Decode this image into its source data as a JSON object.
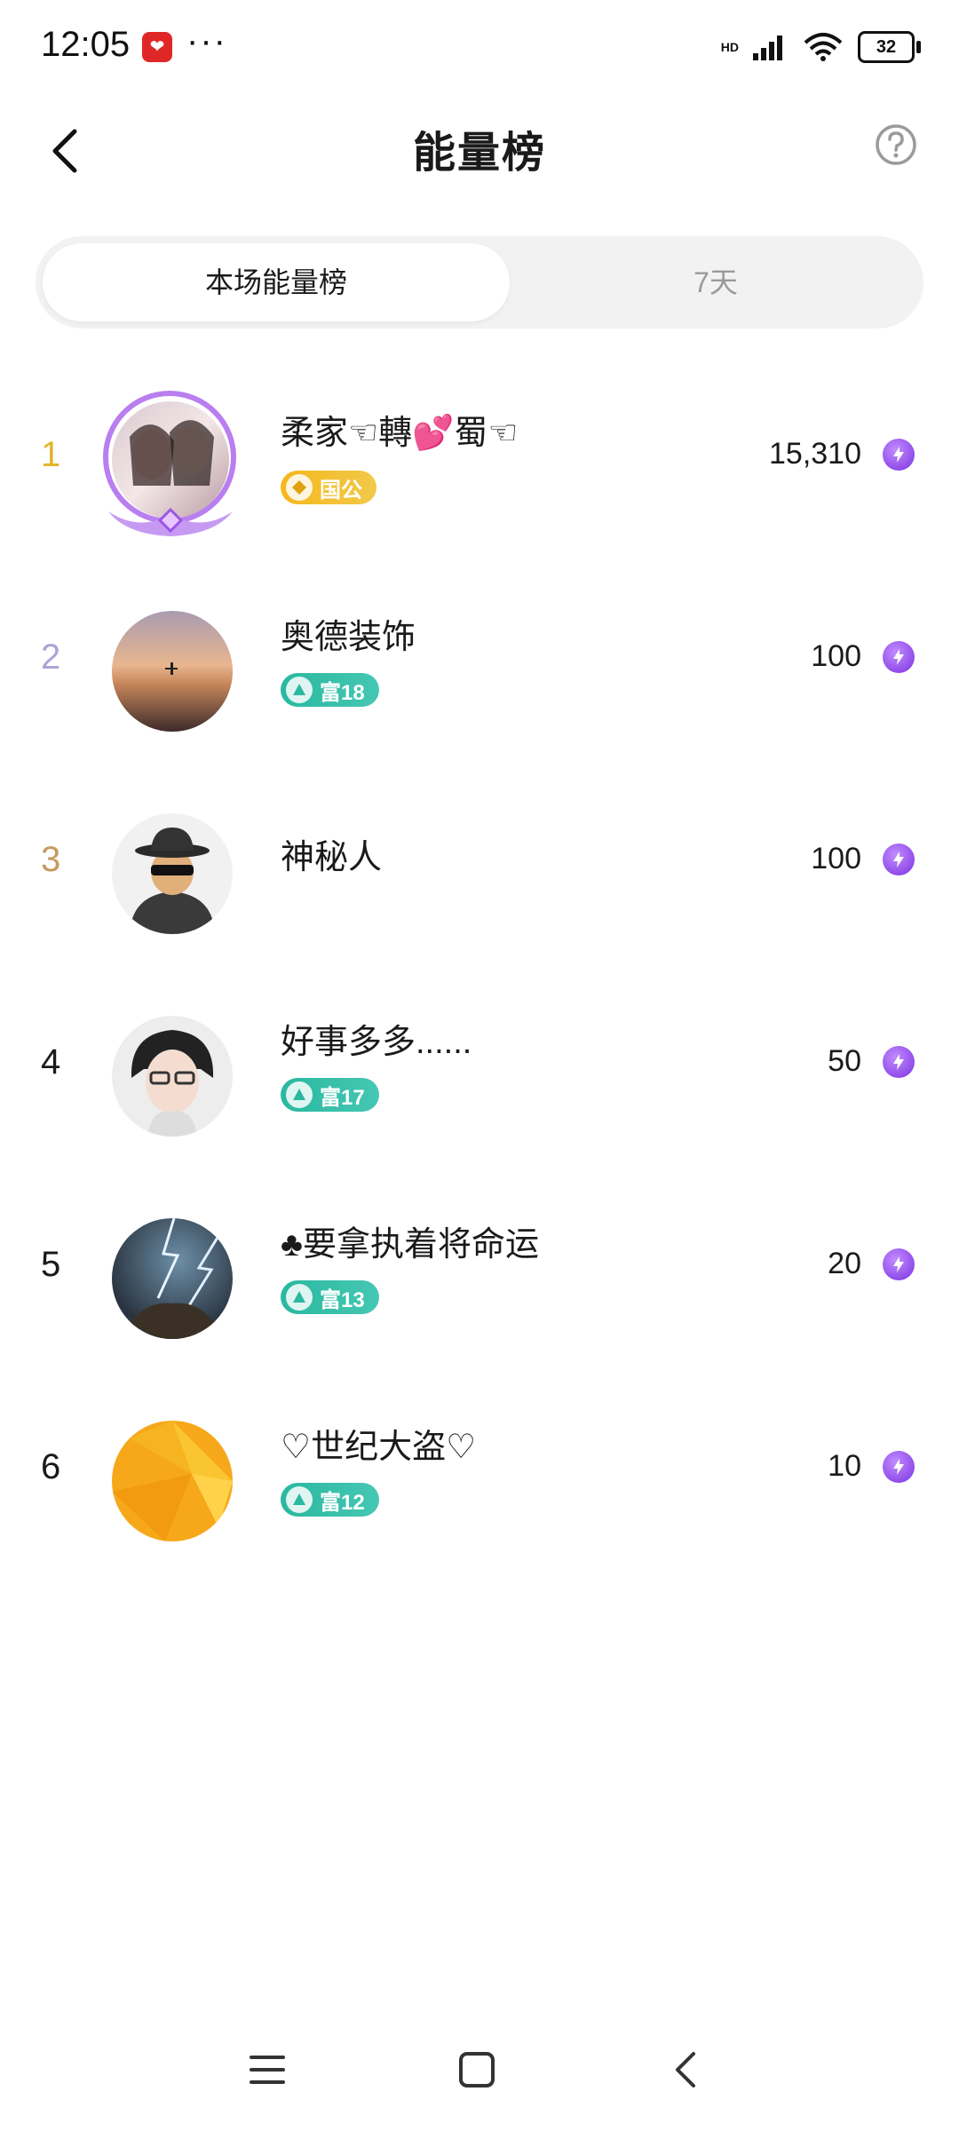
{
  "status_bar": {
    "time": "12:05",
    "app_notification": "app-icon",
    "more": "···",
    "network": "HD",
    "battery": "32"
  },
  "header": {
    "title": "能量榜",
    "back_icon": "back-icon",
    "help_icon": "question-mark-icon"
  },
  "tabs": {
    "active": "本场能量榜",
    "inactive": "7天"
  },
  "ranking": [
    {
      "rank": "1",
      "name": "柔家☜轉💕蜀☜",
      "badge": "国公",
      "badge_type": "gold",
      "score": "15,310"
    },
    {
      "rank": "2",
      "name": "奥德装饰",
      "badge": "富18",
      "badge_type": "green",
      "score": "100"
    },
    {
      "rank": "3",
      "name": "神秘人",
      "badge": "",
      "badge_type": "none",
      "score": "100"
    },
    {
      "rank": "4",
      "name": "好事多多......",
      "badge": "富17",
      "badge_type": "green",
      "score": "50"
    },
    {
      "rank": "5",
      "name": "♣要拿执着将命运",
      "badge": "富13",
      "badge_type": "green",
      "score": "20"
    },
    {
      "rank": "6",
      "name": "♡世纪大盗♡",
      "badge": "富12",
      "badge_type": "green",
      "score": "10"
    }
  ],
  "colors": {
    "rank_1": "#e4b42a",
    "rank_2": "#a9a5d8",
    "rank_3": "#c59a5c",
    "rank_other": "#1a1a1a",
    "energy_icon": "#8a3cf0",
    "badge_green": "#2ab8a0",
    "badge_gold": "#f6b71d"
  }
}
